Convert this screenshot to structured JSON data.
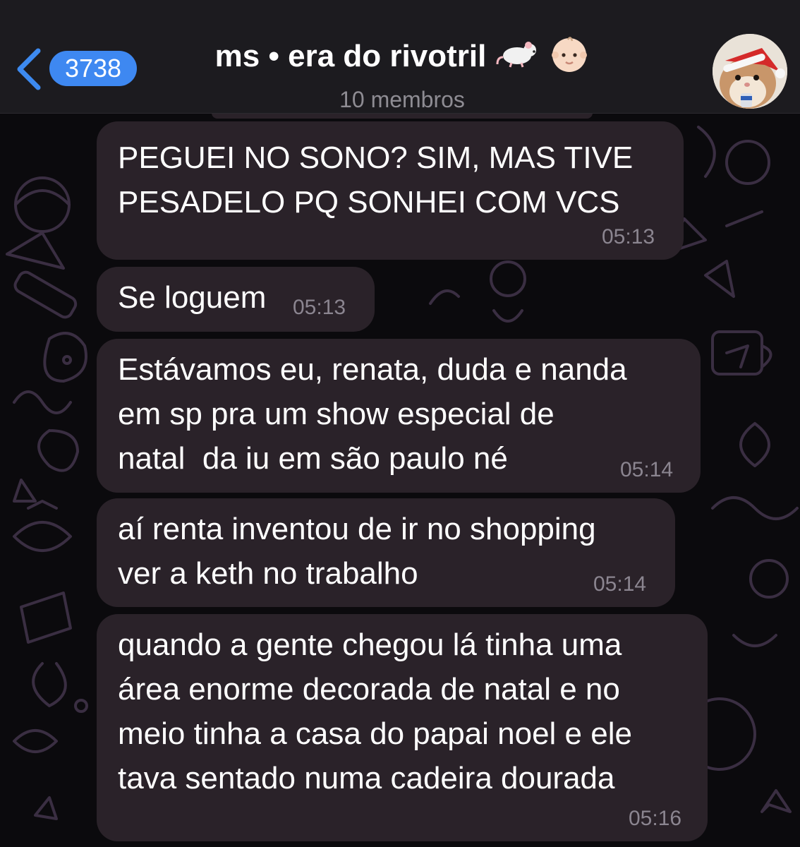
{
  "header": {
    "unread_count": "3738",
    "title": "ms • era do rivotril",
    "subtitle": "10 membros",
    "title_emoji_names": [
      "rat-emoji",
      "baby-emoji"
    ]
  },
  "messages": [
    {
      "lines": [
        "PEGUEI NO SONO? SIM, MAS TIVE",
        "PESADELO PQ SONHEI COM VCS"
      ],
      "time": "05:13"
    },
    {
      "lines": [
        "Se loguem"
      ],
      "time": "05:13"
    },
    {
      "lines": [
        "Estávamos eu, renata, duda e nanda",
        "em sp pra um show especial de",
        "natal  da iu em são paulo né"
      ],
      "time": "05:14"
    },
    {
      "lines": [
        "aí renta inventou de ir no shopping",
        "ver a keth no trabalho"
      ],
      "time": "05:14"
    },
    {
      "lines": [
        "quando a gente chegou lá tinha uma",
        "área enorme decorada de natal e no",
        "meio tinha a casa do papai noel e ele",
        "tava sentado numa cadeira dourada"
      ],
      "time": "05:16"
    }
  ],
  "colors": {
    "accent": "#3e88f1",
    "bubble": "#2a2229",
    "background": "#0b0a0d",
    "header": "#1c1b1f",
    "timestamp": "#8b8590"
  }
}
